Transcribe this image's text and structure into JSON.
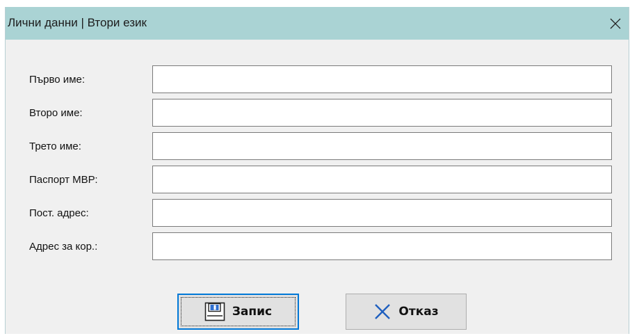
{
  "window": {
    "title": "Лични данни | Втори език"
  },
  "form": {
    "fields": [
      {
        "label": "Първо име:",
        "value": ""
      },
      {
        "label": "Второ име:",
        "value": ""
      },
      {
        "label": "Трето име:",
        "value": ""
      },
      {
        "label": "Паспорт МВР:",
        "value": ""
      },
      {
        "label": "Пост. адрес:",
        "value": ""
      },
      {
        "label": "Адрес за кор.:",
        "value": ""
      }
    ]
  },
  "buttons": {
    "save_label": "Запис",
    "cancel_label": "Отказ"
  },
  "icons": {
    "save": "floppy-disk-icon",
    "cancel": "x-icon",
    "close": "close-icon"
  },
  "colors": {
    "titlebar": "#aad3d4",
    "window_bg": "#f0f0f0",
    "focus_border": "#0078d7",
    "cancel_x": "#1f5fbf"
  }
}
